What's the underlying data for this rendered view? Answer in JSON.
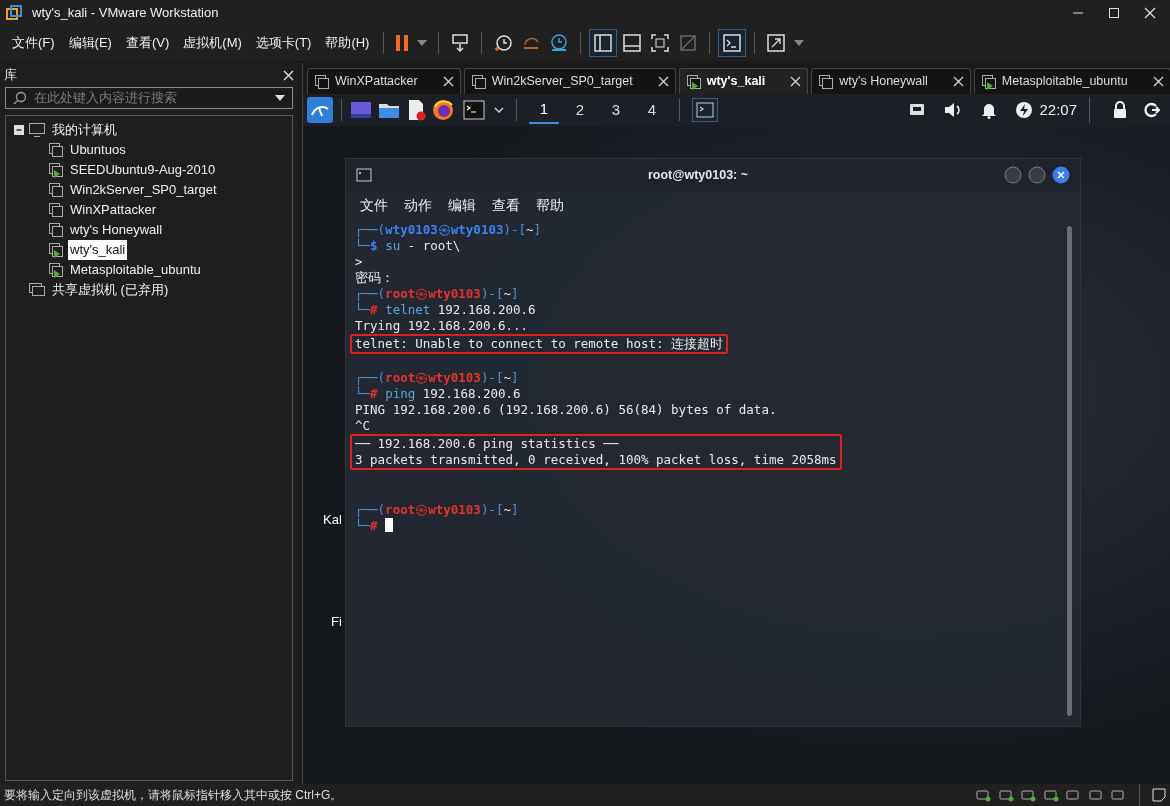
{
  "window": {
    "title": "wty's_kali - VMware Workstation"
  },
  "menu": [
    "文件(F)",
    "编辑(E)",
    "查看(V)",
    "虚拟机(M)",
    "选项卡(T)",
    "帮助(H)"
  ],
  "library": {
    "title": "库",
    "search": {
      "placeholder": "在此处键入内容进行搜索"
    },
    "tree": [
      {
        "label": "我的计算机",
        "kind": "computer",
        "expanded": true,
        "children": [
          {
            "label": "Ubuntuos",
            "kind": "vm",
            "running": false,
            "selected": false
          },
          {
            "label": "SEEDUbuntu9-Aug-2010",
            "kind": "vm",
            "running": true,
            "selected": false
          },
          {
            "label": "Win2kServer_SP0_target",
            "kind": "vm",
            "running": false,
            "selected": false
          },
          {
            "label": "WinXPattacker",
            "kind": "vm",
            "running": false,
            "selected": false
          },
          {
            "label": "wty's Honeywall",
            "kind": "vm",
            "running": false,
            "selected": false
          },
          {
            "label": "wty's_kali",
            "kind": "vm",
            "running": true,
            "selected": true
          },
          {
            "label": "Metasploitable_ubuntu",
            "kind": "vm",
            "running": true,
            "selected": false
          }
        ]
      },
      {
        "label": "共享虚拟机 (已弃用)",
        "kind": "shared"
      }
    ]
  },
  "vm_tabs": [
    {
      "label": "WinXPattacker",
      "selected": false,
      "running": false
    },
    {
      "label": "Win2kServer_SP0_target",
      "selected": false,
      "running": false
    },
    {
      "label": "wty's_kali",
      "selected": true,
      "running": true
    },
    {
      "label": "wty's Honeywall",
      "selected": false,
      "running": false
    },
    {
      "label": "Metasploitable_ubuntu",
      "selected": false,
      "running": true
    }
  ],
  "guest_panel": {
    "workspaces": [
      {
        "label": "1",
        "selected": true
      },
      {
        "label": "2",
        "selected": false
      },
      {
        "label": "3",
        "selected": false
      },
      {
        "label": "4",
        "selected": false
      }
    ],
    "clock": "22:07"
  },
  "desktop_icons": [
    {
      "label": "Kal"
    },
    {
      "label": "Fi"
    }
  ],
  "terminal": {
    "title": "root@wty0103: ~",
    "menu": [
      "文件",
      "动作",
      "编辑",
      "查看",
      "帮助"
    ],
    "lines": [
      {
        "kind": "prompt",
        "open": "┌──(",
        "user": "wty0103",
        "at": "㉿",
        "host": "wty0103",
        "mid": ")-[",
        "dir": "~",
        "close": "]",
        "corner": "└─",
        "sign": "$",
        "color": "#3b82f6",
        "command": "su",
        "args": "- root\\"
      },
      {
        "kind": "output",
        "text": ">"
      },
      {
        "kind": "output",
        "text": "密码："
      },
      {
        "kind": "prompt",
        "open": "┌──(",
        "user": "root",
        "at": "㉿",
        "host": "wty0103",
        "mid": ")-[",
        "dir": "~",
        "close": "]",
        "corner": "└─",
        "sign": "#",
        "color": "#e5322d",
        "command": "telnet",
        "args": "192.168.200.6"
      },
      {
        "kind": "output",
        "text": "Trying 192.168.200.6..."
      },
      {
        "kind": "boxed",
        "lines": [
          "telnet: Unable to connect to remote host: 连接超时"
        ]
      },
      {
        "kind": "blank"
      },
      {
        "kind": "prompt",
        "open": "┌──(",
        "user": "root",
        "at": "㉿",
        "host": "wty0103",
        "mid": ")-[",
        "dir": "~",
        "close": "]",
        "corner": "└─",
        "sign": "#",
        "color": "#e5322d",
        "command": "ping",
        "args": "192.168.200.6"
      },
      {
        "kind": "output",
        "text": "PING 192.168.200.6 (192.168.200.6) 56(84) bytes of data."
      },
      {
        "kind": "output",
        "text": "^C"
      },
      {
        "kind": "boxed",
        "lines": [
          "── 192.168.200.6 ping statistics ──",
          "3 packets transmitted, 0 received, 100% packet loss, time 2058ms"
        ]
      },
      {
        "kind": "blank"
      },
      {
        "kind": "blank"
      },
      {
        "kind": "prompt",
        "open": "┌──(",
        "user": "root",
        "at": "㉿",
        "host": "wty0103",
        "mid": ")-[",
        "dir": "~",
        "close": "]",
        "corner": "└─",
        "sign": "#",
        "color": "#e5322d",
        "cursor": true
      }
    ]
  },
  "status_bar": {
    "text": "要将输入定向到该虚拟机，请将鼠标指针移入其中或按 Ctrl+G。"
  }
}
